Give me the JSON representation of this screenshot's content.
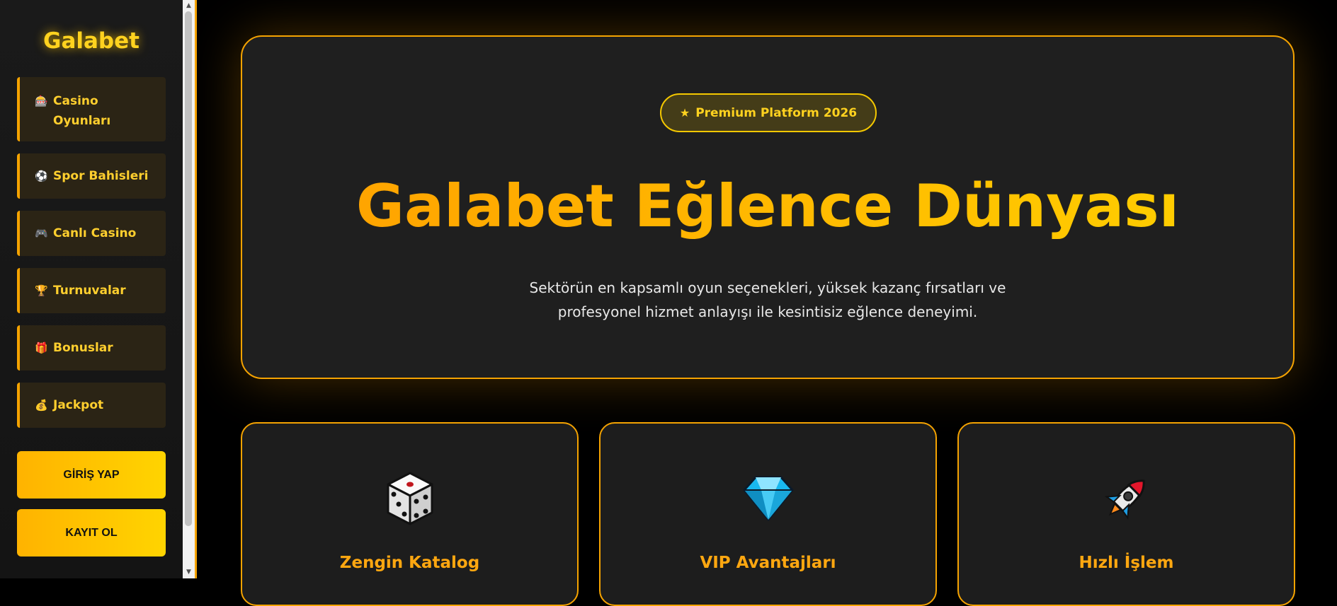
{
  "sidebar": {
    "brand": "Galabet",
    "items": [
      {
        "icon": "slot-machine-icon",
        "label": "Casino Oyunları"
      },
      {
        "icon": "soccer-ball-icon",
        "label": "Spor Bahisleri"
      },
      {
        "icon": "gamepad-icon",
        "label": "Canlı Casino"
      },
      {
        "icon": "trophy-icon",
        "label": "Turnuvalar"
      },
      {
        "icon": "gift-icon",
        "label": "Bonuslar"
      },
      {
        "icon": "money-bag-icon",
        "label": "Jackpot"
      }
    ],
    "login_label": "GİRİŞ YAP",
    "signup_label": "KAYIT OL"
  },
  "hero": {
    "badge": "Premium Platform 2026",
    "badge_icon": "star-icon",
    "title": "Galabet Eğlence Dünyası",
    "description_line1": "Sektörün en kapsamlı oyun seçenekleri, yüksek kazanç fırsatları ve",
    "description_line2": "profesyonel hizmet anlayışı ile kesintisiz eğlence deneyimi."
  },
  "features": [
    {
      "icon": "dice-icon",
      "title": "Zengin Katalog"
    },
    {
      "icon": "diamond-icon",
      "title": "VIP Avantajları"
    },
    {
      "icon": "rocket-icon",
      "title": "Hızlı İşlem"
    }
  ],
  "colors": {
    "accent": "#f5a300",
    "gold": "#ffd21f",
    "background": "#000000",
    "panel": "#1f1f1f",
    "nav_item": "#2b2415"
  }
}
